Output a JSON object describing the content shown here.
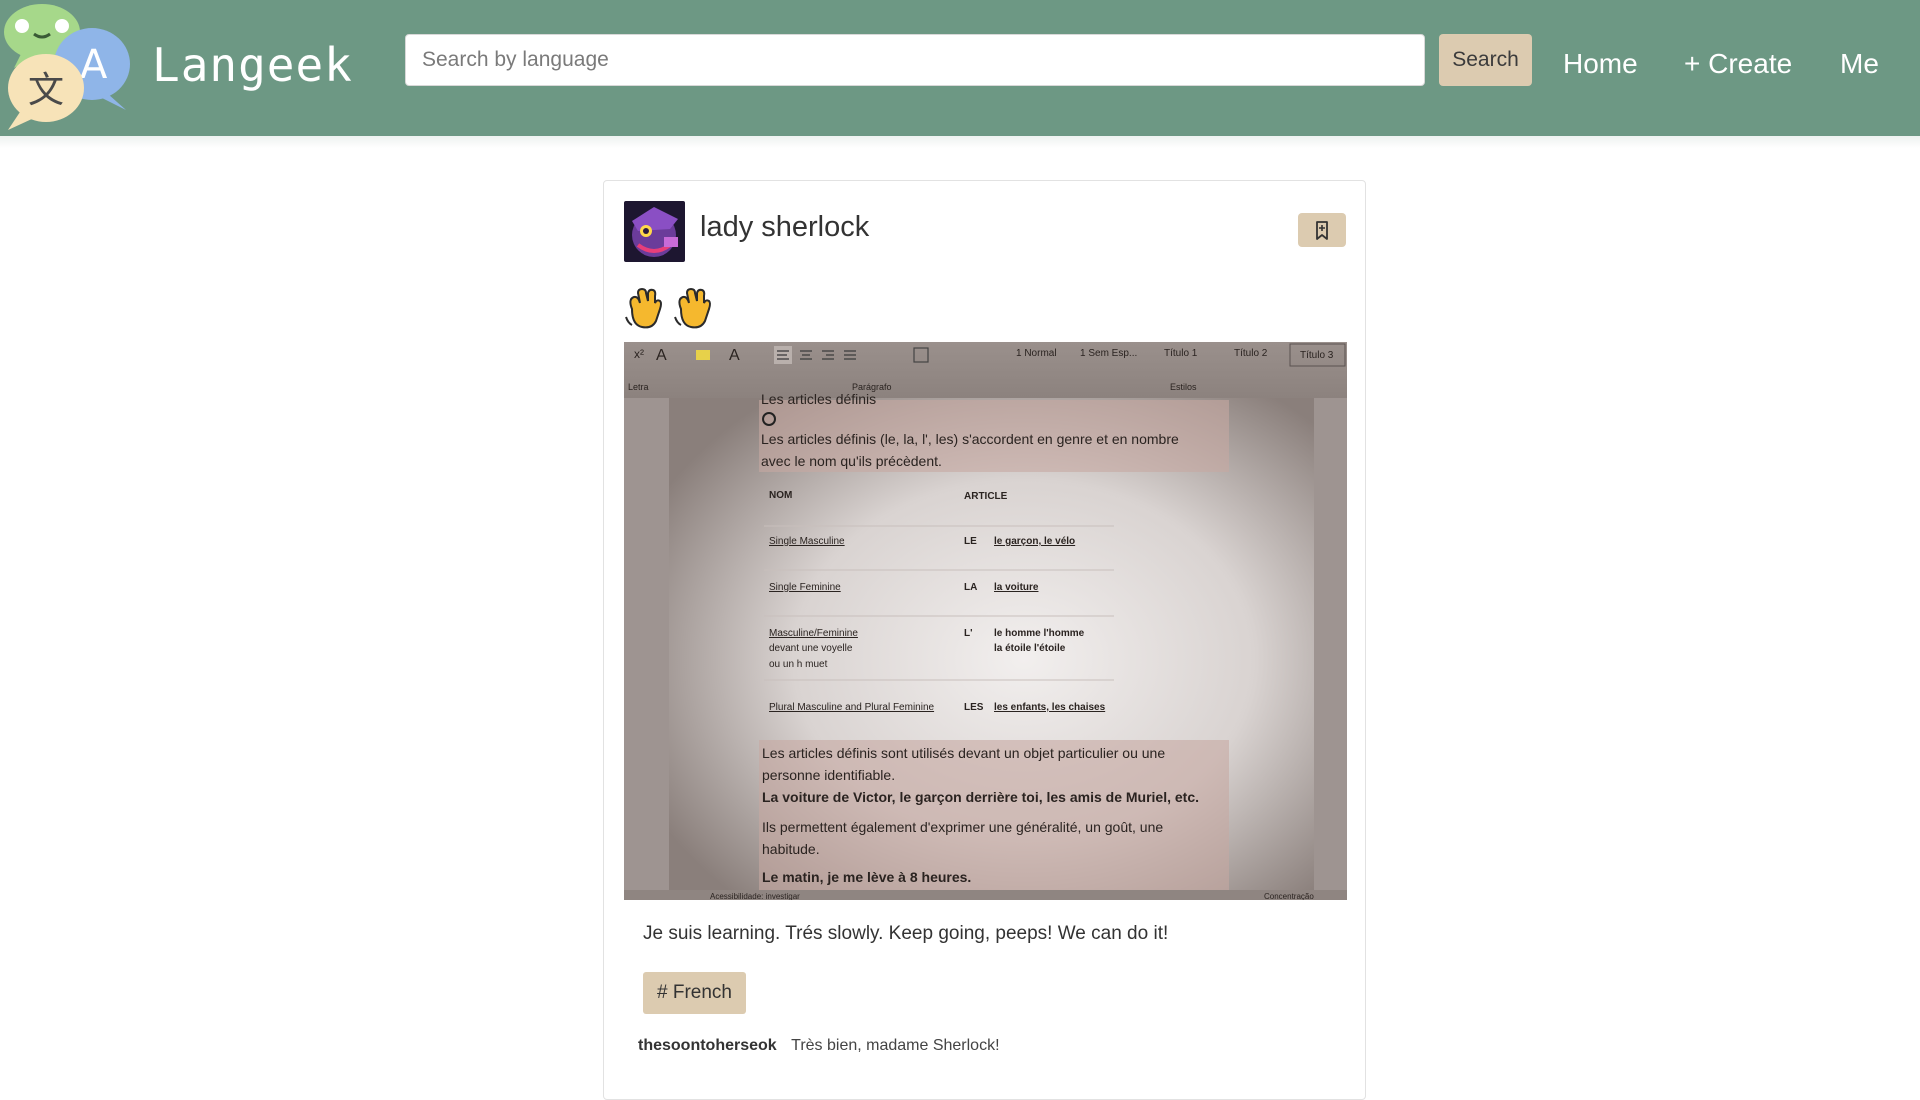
{
  "brand": {
    "name": "Langeek"
  },
  "search": {
    "placeholder": "Search by language",
    "value": "",
    "button_label": "Search"
  },
  "nav": {
    "home": "Home",
    "create": "+ Create",
    "me": "Me"
  },
  "post": {
    "author": "lady sherlock",
    "emojis": [
      "waving-hand",
      "waving-hand"
    ],
    "text": "Je suis learning. Trés slowly. Keep going, peeps! We can do it!",
    "tag": "# French",
    "image": {
      "toolbar_styles": [
        "1 Normal",
        "1 Sem Esp...",
        "Título 1",
        "Título 2",
        "Título 3"
      ],
      "toolbar_groups": [
        "Letra",
        "Parágrafo",
        "Estilos"
      ],
      "heading": "Les articles définis",
      "intro_line1": "Les articles définis (le, la, l', les) s'accordent en genre et en nombre",
      "intro_line2": "avec le nom qu'ils précèdent.",
      "table_headers": [
        "NOM",
        "ARTICLE"
      ],
      "rows": [
        {
          "nom": "Single Masculine",
          "article": "LE",
          "example": "le garçon, le vélo"
        },
        {
          "nom": "Single Feminine",
          "article": "LA",
          "example": "la voiture"
        },
        {
          "nom": "Masculine/Feminine",
          "nom_extra1": "devant une voyelle",
          "nom_extra2": "ou un h muet",
          "article": "L'",
          "example": "le homme  l'homme",
          "example2": "la étoile  l'étoile"
        },
        {
          "nom": "Plural Masculine and Plural Feminine",
          "article": "LES",
          "example": "les enfants, les chaises"
        }
      ],
      "usage_line1": "Les articles définis sont utilisés devant un objet particulier ou une",
      "usage_line2": "personne identifiable.",
      "usage_example": "La voiture de Victor, le garçon derrière toi, les amis de Muriel, etc.",
      "generality_line1": "Ils permettent également d'exprimer une généralité, un goût, une",
      "generality_line2": "habitude.",
      "generality_example": "Le matin, je me lève à 8 heures.",
      "status_left": "Acessibilidade: investigar",
      "status_right": "Concentração"
    }
  },
  "comment": {
    "author": "thesoontoherseok",
    "text": "Très bien, madame Sherlock!"
  },
  "colors": {
    "header": "#6d9884",
    "accent": "#dccbb0",
    "text": "#333333"
  }
}
